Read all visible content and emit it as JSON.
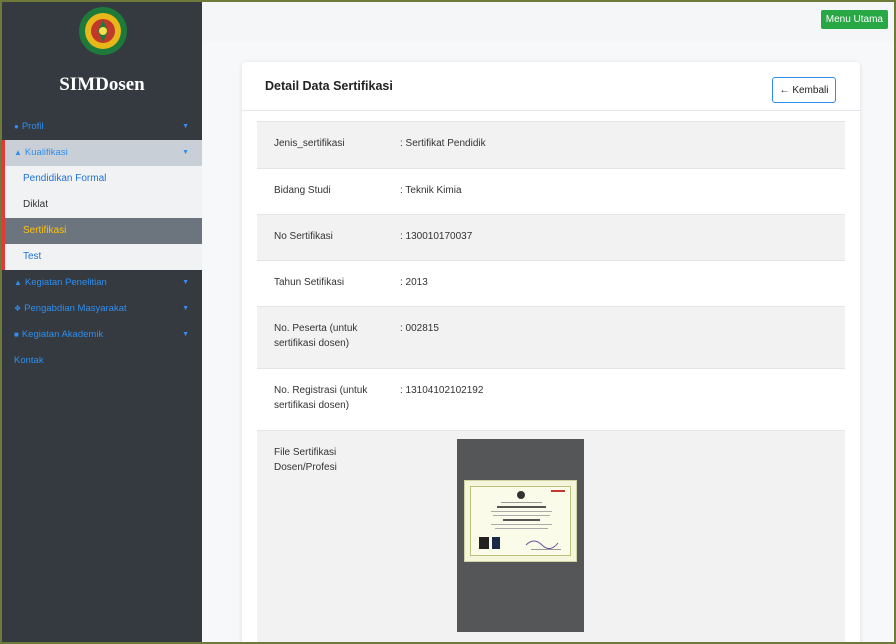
{
  "sidebar": {
    "brand": "SIMDosen",
    "profil": "Profil",
    "kualifikasi": "Kualifikasi",
    "sub_items": [
      "Pendidikan Formal",
      "Diklat",
      "Sertifikasi",
      "Test"
    ],
    "penelitian": "Kegiatan Penelitian",
    "pengabdian": "Pengabdian Masyarakat",
    "akademik": "Kegiatan Akademik",
    "kontak": "Kontak"
  },
  "topbar": {
    "menu_label": "Menu Utama"
  },
  "card": {
    "title": "Detail Data Sertifikasi",
    "back_label": "← Kembali",
    "rows": [
      {
        "label": "Jenis_sertifikasi",
        "value": ": Sertifikat Pendidik"
      },
      {
        "label": "Bidang Studi",
        "value": ": Teknik Kimia"
      },
      {
        "label": "No Sertifikasi",
        "value": ": 130010170037"
      },
      {
        "label": "Tahun Setifikasi",
        "value": ": 2013"
      },
      {
        "label": "No. Peserta (untuk sertifikasi dosen)",
        "value": ": 002815"
      },
      {
        "label": "No. Registrasi (untuk sertifikasi dosen)",
        "value": ": 13104102102192"
      },
      {
        "label": "File Sertifikasi Dosen/Profesi",
        "value": ""
      }
    ]
  },
  "colors": {
    "accent": "#2f8ef0",
    "sidebar": "#343a40",
    "active": "#ffc107",
    "marker": "#e23a3a",
    "menu_button": "#28a745"
  },
  "icons": {
    "profil": "user-icon",
    "kualifikasi": "graduation-cap-icon",
    "penelitian": "flask-icon",
    "pengabdian": "handshake-icon",
    "akademik": "chalkboard-icon",
    "caret": "caret-down-icon",
    "back": "arrow-left-icon"
  }
}
